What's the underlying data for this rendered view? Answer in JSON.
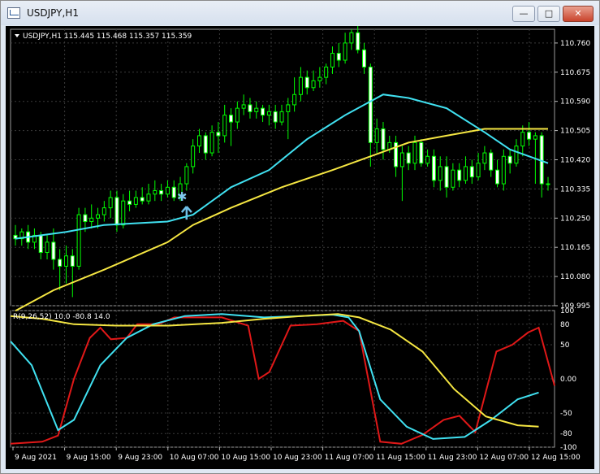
{
  "window": {
    "title": "USDJPY,H1",
    "minimize_glyph": "—",
    "maximize_glyph": "□",
    "close_glyph": "✕"
  },
  "colors": {
    "background": "#000000",
    "grid": "#3a3a3a",
    "candle_up": "#00ff00",
    "ma_fast": "#40e0f0",
    "ma_slow": "#f5e642",
    "osc_red": "#e01818",
    "axis_text": "#ffffff"
  },
  "main_header": "USDJPY,H1  115.445 115.468 115.357 115.359",
  "osc_header": "R(9,26,52) 10.0 -80.8 14.0",
  "price_ticks": [
    "110.760",
    "110.675",
    "110.590",
    "110.505",
    "110.420",
    "110.335",
    "110.250",
    "110.165",
    "110.080",
    "109.995"
  ],
  "osc_ticks": [
    "100",
    "80",
    "50",
    "0.00",
    "-50",
    "-80",
    "-100"
  ],
  "time_ticks": [
    "9 Aug 2021",
    "9 Aug 15:00",
    "9 Aug 23:00",
    "10 Aug 07:00",
    "10 Aug 15:00",
    "10 Aug 23:00",
    "11 Aug 07:00",
    "11 Aug 15:00",
    "11 Aug 23:00",
    "12 Aug 07:00",
    "12 Aug 15:00"
  ],
  "chart_data": {
    "type": "candlestick",
    "symbol": "USDJPY",
    "timeframe": "H1",
    "ylim": [
      109.995,
      110.8
    ],
    "candles": [
      [
        110.2,
        110.19,
        110.23,
        110.17
      ],
      [
        110.19,
        110.21,
        110.22,
        110.17
      ],
      [
        110.21,
        110.18,
        110.23,
        110.16
      ],
      [
        110.18,
        110.2,
        110.22,
        110.16
      ],
      [
        110.2,
        110.15,
        110.21,
        110.13
      ],
      [
        110.15,
        110.18,
        110.2,
        110.13
      ],
      [
        110.18,
        110.13,
        110.22,
        110.1
      ],
      [
        110.13,
        110.11,
        110.16,
        110.04
      ],
      [
        110.11,
        110.14,
        110.17,
        110.06
      ],
      [
        110.14,
        110.11,
        110.16,
        110.02
      ],
      [
        110.11,
        110.26,
        110.28,
        110.1
      ],
      [
        110.26,
        110.24,
        110.28,
        110.21
      ],
      [
        110.24,
        110.25,
        110.29,
        110.22
      ],
      [
        110.25,
        110.26,
        110.28,
        110.22
      ],
      [
        110.26,
        110.28,
        110.3,
        110.24
      ],
      [
        110.28,
        110.31,
        110.33,
        110.25
      ],
      [
        110.31,
        110.23,
        110.33,
        110.21
      ],
      [
        110.23,
        110.3,
        110.32,
        110.22
      ],
      [
        110.3,
        110.29,
        110.33,
        110.27
      ],
      [
        110.29,
        110.31,
        110.33,
        110.28
      ],
      [
        110.31,
        110.3,
        110.34,
        110.29
      ],
      [
        110.3,
        110.32,
        110.35,
        110.29
      ],
      [
        110.32,
        110.33,
        110.36,
        110.3
      ],
      [
        110.33,
        110.32,
        110.35,
        110.3
      ],
      [
        110.32,
        110.34,
        110.36,
        110.31
      ],
      [
        110.34,
        110.31,
        110.36,
        110.3
      ],
      [
        110.31,
        110.35,
        110.37,
        110.3
      ],
      [
        110.35,
        110.4,
        110.41,
        110.33
      ],
      [
        110.4,
        110.46,
        110.48,
        110.38
      ],
      [
        110.46,
        110.49,
        110.51,
        110.44
      ],
      [
        110.49,
        110.44,
        110.5,
        110.42
      ],
      [
        110.44,
        110.5,
        110.52,
        110.43
      ],
      [
        110.5,
        110.49,
        110.53,
        110.44
      ],
      [
        110.49,
        110.55,
        110.58,
        110.47
      ],
      [
        110.55,
        110.53,
        110.57,
        110.46
      ],
      [
        110.53,
        110.57,
        110.59,
        110.51
      ],
      [
        110.57,
        110.58,
        110.61,
        110.55
      ],
      [
        110.58,
        110.56,
        110.6,
        110.54
      ],
      [
        110.56,
        110.57,
        110.59,
        110.54
      ],
      [
        110.57,
        110.55,
        110.58,
        110.53
      ],
      [
        110.55,
        110.56,
        110.58,
        110.52
      ],
      [
        110.56,
        110.53,
        110.58,
        110.51
      ],
      [
        110.53,
        110.56,
        110.58,
        110.52
      ],
      [
        110.56,
        110.58,
        110.6,
        110.48
      ],
      [
        110.58,
        110.61,
        110.66,
        110.56
      ],
      [
        110.61,
        110.66,
        110.69,
        110.59
      ],
      [
        110.66,
        110.63,
        110.68,
        110.61
      ],
      [
        110.63,
        110.65,
        110.68,
        110.62
      ],
      [
        110.65,
        110.66,
        110.69,
        110.63
      ],
      [
        110.66,
        110.69,
        110.7,
        110.64
      ],
      [
        110.69,
        110.73,
        110.75,
        110.67
      ],
      [
        110.73,
        110.71,
        110.76,
        110.69
      ],
      [
        110.71,
        110.76,
        110.79,
        110.7
      ],
      [
        110.76,
        110.79,
        110.8,
        110.74
      ],
      [
        110.79,
        110.74,
        110.81,
        110.73
      ],
      [
        110.74,
        110.69,
        110.76,
        110.67
      ],
      [
        110.69,
        110.47,
        110.7,
        110.4
      ],
      [
        110.47,
        110.51,
        110.54,
        110.44
      ],
      [
        110.51,
        110.45,
        110.53,
        110.42
      ],
      [
        110.45,
        110.47,
        110.49,
        110.44
      ],
      [
        110.47,
        110.4,
        110.49,
        110.37
      ],
      [
        110.4,
        110.44,
        110.46,
        110.3
      ],
      [
        110.44,
        110.41,
        110.46,
        110.39
      ],
      [
        110.41,
        110.47,
        110.49,
        110.39
      ],
      [
        110.47,
        110.41,
        110.48,
        110.4
      ],
      [
        110.41,
        110.43,
        110.45,
        110.4
      ],
      [
        110.43,
        110.36,
        110.45,
        110.34
      ],
      [
        110.36,
        110.4,
        110.43,
        110.33
      ],
      [
        110.4,
        110.34,
        110.43,
        110.31
      ],
      [
        110.34,
        110.39,
        110.41,
        110.33
      ],
      [
        110.39,
        110.36,
        110.41,
        110.34
      ],
      [
        110.36,
        110.4,
        110.43,
        110.35
      ],
      [
        110.4,
        110.37,
        110.42,
        110.35
      ],
      [
        110.37,
        110.41,
        110.44,
        110.36
      ],
      [
        110.41,
        110.44,
        110.46,
        110.39
      ],
      [
        110.44,
        110.39,
        110.45,
        110.37
      ],
      [
        110.39,
        110.35,
        110.42,
        110.34
      ],
      [
        110.35,
        110.43,
        110.45,
        110.33
      ],
      [
        110.43,
        110.41,
        110.45,
        110.38
      ],
      [
        110.41,
        110.46,
        110.48,
        110.4
      ],
      [
        110.46,
        110.5,
        110.52,
        110.43
      ],
      [
        110.5,
        110.48,
        110.53,
        110.46
      ],
      [
        110.48,
        110.49,
        110.5,
        110.35
      ],
      [
        110.49,
        110.35,
        110.5,
        110.31
      ],
      [
        110.35,
        110.35,
        110.37,
        110.33
      ]
    ],
    "ma_fast": [
      [
        0,
        110.19
      ],
      [
        8,
        110.21
      ],
      [
        14,
        110.23
      ],
      [
        24,
        110.24
      ],
      [
        28,
        110.26
      ],
      [
        34,
        110.34
      ],
      [
        40,
        110.39
      ],
      [
        46,
        110.48
      ],
      [
        52,
        110.55
      ],
      [
        58,
        110.61
      ],
      [
        62,
        110.6
      ],
      [
        68,
        110.57
      ],
      [
        74,
        110.5
      ],
      [
        78,
        110.45
      ],
      [
        84,
        110.41
      ]
    ],
    "ma_slow": [
      [
        0,
        109.98
      ],
      [
        6,
        110.04
      ],
      [
        14,
        110.1
      ],
      [
        24,
        110.18
      ],
      [
        28,
        110.23
      ],
      [
        34,
        110.28
      ],
      [
        42,
        110.34
      ],
      [
        50,
        110.39
      ],
      [
        56,
        110.43
      ],
      [
        62,
        110.47
      ],
      [
        68,
        110.49
      ],
      [
        74,
        110.51
      ],
      [
        80,
        110.51
      ],
      [
        84,
        110.51
      ]
    ],
    "osc_ylim": [
      -100,
      100
    ],
    "osc_series": [
      {
        "color": "#e01818",
        "values": [
          [
            0,
            -95
          ],
          [
            6,
            -92
          ],
          [
            9,
            -83
          ],
          [
            12,
            0
          ],
          [
            15,
            60
          ],
          [
            17,
            75
          ],
          [
            19,
            58
          ],
          [
            22,
            60
          ],
          [
            24,
            80
          ],
          [
            28,
            80
          ],
          [
            31,
            90
          ],
          [
            40,
            90
          ],
          [
            45,
            78
          ],
          [
            47,
            0
          ],
          [
            49,
            10
          ],
          [
            53,
            78
          ],
          [
            58,
            80
          ],
          [
            63,
            85
          ],
          [
            66,
            70
          ],
          [
            70,
            -92
          ],
          [
            74,
            -95
          ],
          [
            78,
            -82
          ],
          [
            82,
            -60
          ],
          [
            85,
            -54
          ],
          [
            88,
            -78
          ],
          [
            92,
            40
          ],
          [
            95,
            50
          ],
          [
            98,
            68
          ],
          [
            100,
            75
          ],
          [
            103,
            -10
          ]
        ]
      },
      {
        "color": "#40e0f0",
        "values": [
          [
            0,
            55
          ],
          [
            4,
            20
          ],
          [
            9,
            -75
          ],
          [
            12,
            -60
          ],
          [
            17,
            20
          ],
          [
            22,
            60
          ],
          [
            27,
            80
          ],
          [
            33,
            92
          ],
          [
            40,
            95
          ],
          [
            48,
            90
          ],
          [
            55,
            92
          ],
          [
            61,
            94
          ],
          [
            64,
            90
          ],
          [
            66,
            70
          ],
          [
            70,
            -30
          ],
          [
            75,
            -70
          ],
          [
            80,
            -88
          ],
          [
            86,
            -85
          ],
          [
            91,
            -60
          ],
          [
            96,
            -30
          ],
          [
            100,
            -20
          ]
        ]
      },
      {
        "color": "#f5e642",
        "values": [
          [
            0,
            92
          ],
          [
            6,
            88
          ],
          [
            12,
            80
          ],
          [
            20,
            78
          ],
          [
            30,
            78
          ],
          [
            40,
            82
          ],
          [
            48,
            88
          ],
          [
            55,
            92
          ],
          [
            62,
            95
          ],
          [
            66,
            90
          ],
          [
            72,
            72
          ],
          [
            78,
            40
          ],
          [
            84,
            -15
          ],
          [
            90,
            -55
          ],
          [
            96,
            -68
          ],
          [
            100,
            -70
          ]
        ]
      }
    ]
  }
}
